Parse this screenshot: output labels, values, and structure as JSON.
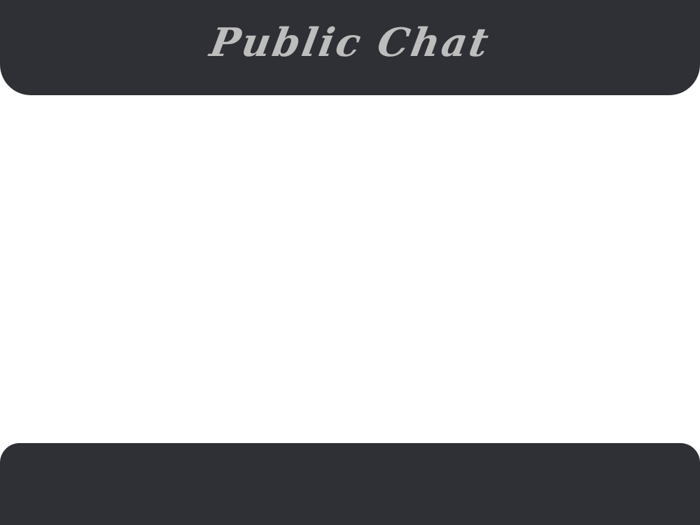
{
  "header": {
    "title": "Public Chat"
  },
  "colors": {
    "bar_background": "#2f3035",
    "title_text": "#bdbdbd",
    "content_background": "#ffffff"
  }
}
